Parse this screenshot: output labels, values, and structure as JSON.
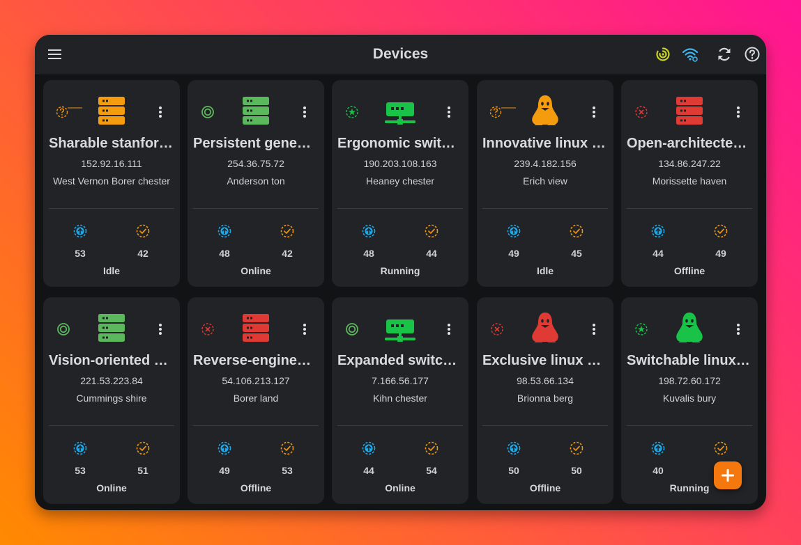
{
  "appbar": {
    "title": "Devices"
  },
  "icons": {
    "menu": "hamburger-menu-icon",
    "activity": "activity-ring-icon",
    "wifi": "wifi-settings-icon",
    "refresh": "refresh-icon",
    "help": "help-circle-icon",
    "add": "plus-icon"
  },
  "colors": {
    "accent": "#f5780f",
    "yellow_status": "#c9d32a",
    "wifi_blue": "#3fb6ef",
    "upload_blue": "#1fa8e8",
    "check_orange": "#ee9611",
    "server_orange": "#f59b0e",
    "server_green": "#5cb85c",
    "server_red": "#e03a35",
    "switch_green": "#18c347",
    "linux_orange": "#f59b0e",
    "linux_red": "#e03a35",
    "linux_green": "#18c347"
  },
  "devices": [
    {
      "name": "Sharable stanford server",
      "ip": "152.92.16.111",
      "location": "West Vernon Borer chester",
      "up": "53",
      "ok": "42",
      "status": "Idle",
      "status_icon": "unknown",
      "device_icon": "server",
      "device_color": "orange"
    },
    {
      "name": "Persistent geneva server",
      "ip": "254.36.75.72",
      "location": "Anderson ton",
      "up": "48",
      "ok": "42",
      "status": "Online",
      "status_icon": "online",
      "device_icon": "server",
      "device_color": "green"
    },
    {
      "name": "Ergonomic switch hub",
      "ip": "190.203.108.163",
      "location": "Heaney chester",
      "up": "48",
      "ok": "44",
      "status": "Running",
      "status_icon": "running",
      "device_icon": "switch",
      "device_color": "green"
    },
    {
      "name": "Innovative linux host",
      "ip": "239.4.182.156",
      "location": "Erich view",
      "up": "49",
      "ok": "45",
      "status": "Idle",
      "status_icon": "unknown",
      "device_icon": "linux",
      "device_color": "orange"
    },
    {
      "name": "Open-architected server",
      "ip": "134.86.247.22",
      "location": "Morissette haven",
      "up": "44",
      "ok": "49",
      "status": "Offline",
      "status_icon": "offline",
      "device_icon": "server",
      "device_color": "red"
    },
    {
      "name": "Vision-oriented server",
      "ip": "221.53.223.84",
      "location": "Cummings shire",
      "up": "53",
      "ok": "51",
      "status": "Online",
      "status_icon": "online",
      "device_icon": "server",
      "device_color": "green"
    },
    {
      "name": "Reverse-engineered server",
      "ip": "54.106.213.127",
      "location": "Borer land",
      "up": "49",
      "ok": "53",
      "status": "Offline",
      "status_icon": "offline",
      "device_icon": "server",
      "device_color": "red"
    },
    {
      "name": "Expanded switch hub",
      "ip": "7.166.56.177",
      "location": "Kihn chester",
      "up": "44",
      "ok": "54",
      "status": "Online",
      "status_icon": "online",
      "device_icon": "switch",
      "device_color": "green"
    },
    {
      "name": "Exclusive linux client",
      "ip": "98.53.66.134",
      "location": "Brionna berg",
      "up": "50",
      "ok": "50",
      "status": "Offline",
      "status_icon": "offline",
      "device_icon": "linux",
      "device_color": "red"
    },
    {
      "name": "Switchable linux host",
      "ip": "198.72.60.172",
      "location": "Kuvalis bury",
      "up": "40",
      "ok": "",
      "status": "Running",
      "status_icon": "running",
      "device_icon": "linux",
      "device_color": "green"
    }
  ]
}
